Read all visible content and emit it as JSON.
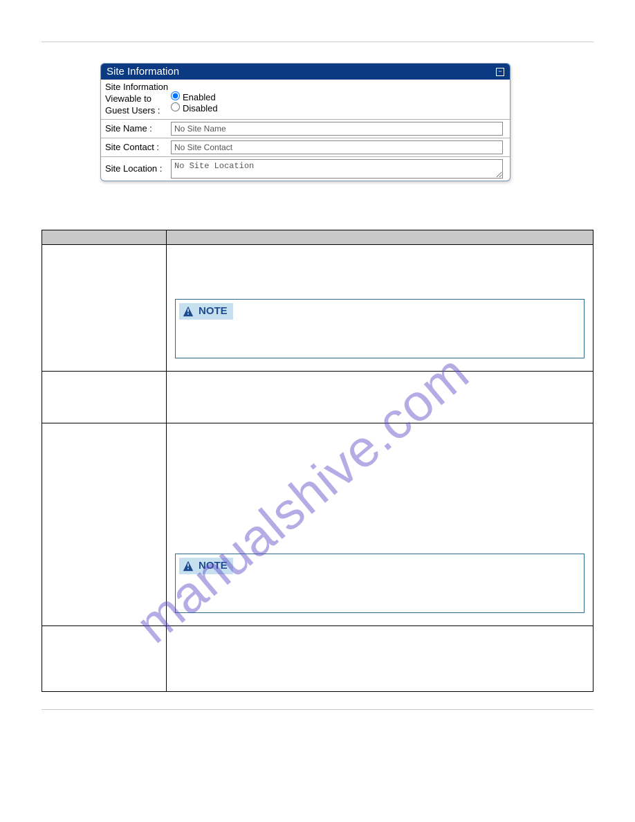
{
  "panel": {
    "title": "Site Information",
    "field_viewable_label": "Site Information Viewable to Guest Users :",
    "radio_enabled": "Enabled",
    "radio_disabled": "Disabled",
    "field_name_label": "Site Name :",
    "field_name_value": "No Site Name",
    "field_contact_label": "Site Contact :",
    "field_contact_value": "No Site Contact",
    "field_location_label": "Site Location :",
    "field_location_value": "No Site Location"
  },
  "table": {
    "header_item": "",
    "header_desc": ""
  },
  "note_label": "NOTE",
  "watermark": "manualshive.com"
}
